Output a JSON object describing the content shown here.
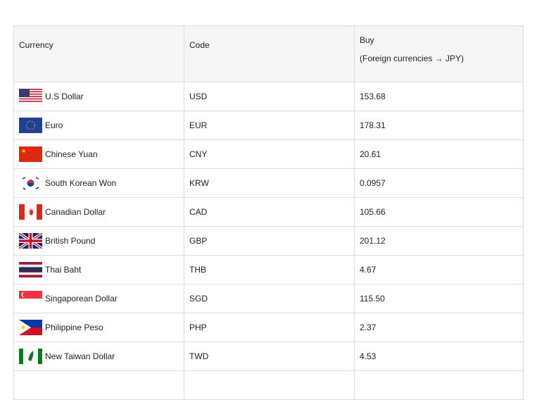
{
  "headers": {
    "currency": "Currency",
    "code": "Code",
    "buy": "Buy",
    "buy_note": "(Foreign currencies → JPY)"
  },
  "rows": [
    {
      "name": "U.S Dollar",
      "code": "USD",
      "buy": "153.68",
      "flag": "us-flag"
    },
    {
      "name": "Euro",
      "code": "EUR",
      "buy": "178.31",
      "flag": "eu-flag"
    },
    {
      "name": "Chinese Yuan",
      "code": "CNY",
      "buy": "20.61",
      "flag": "cn-flag"
    },
    {
      "name": "South Korean Won",
      "code": "KRW",
      "buy": "0.0957",
      "flag": "kr-flag"
    },
    {
      "name": "Canadian Dollar",
      "code": "CAD",
      "buy": "105.66",
      "flag": "ca-flag"
    },
    {
      "name": "British Pound",
      "code": "GBP",
      "buy": "201.12",
      "flag": "gb-flag"
    },
    {
      "name": "Thai Baht",
      "code": "THB",
      "buy": "4.67",
      "flag": "th-flag"
    },
    {
      "name": "Singaporean Dollar",
      "code": "SGD",
      "buy": "115.50",
      "flag": "sg-flag"
    },
    {
      "name": "Philippine Peso",
      "code": "PHP",
      "buy": "2.37",
      "flag": "ph-flag"
    },
    {
      "name": "New Taiwan Dollar",
      "code": "TWD",
      "buy": "4.53",
      "flag": "tw-flag"
    }
  ]
}
